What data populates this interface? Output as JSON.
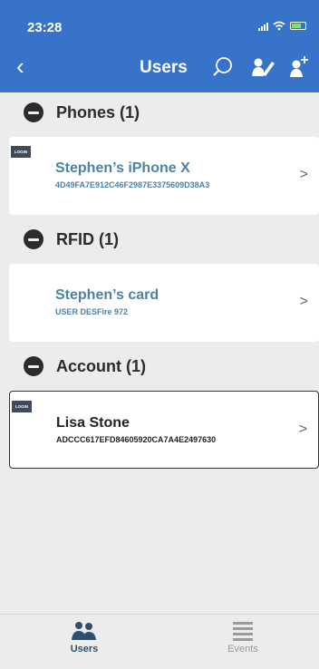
{
  "status_bar": {
    "time": "23:28"
  },
  "nav": {
    "title": "Users",
    "icons": [
      "back-chevron",
      "search-icon",
      "edit-user-icon",
      "add-user-icon"
    ]
  },
  "sections": [
    {
      "title": "Phones (1)",
      "items": [
        {
          "badge": "LOGIN",
          "name": "Stephen’s iPhone X",
          "detail": "4D49FA7E912C46F2987E3375609D38A3"
        }
      ]
    },
    {
      "title": "RFID (1)",
      "items": [
        {
          "name": "Stephen’s card",
          "detail": "USER DESFire 972"
        }
      ]
    },
    {
      "title": "Account (1)",
      "items": [
        {
          "badge": "LOGIN",
          "name": "Lisa Stone",
          "detail": "ADCCC617EFD84605920CA7A4E2497630"
        }
      ]
    }
  ],
  "tab_bar": {
    "tabs": [
      {
        "label": "Users",
        "icon": "users-icon",
        "active": true
      },
      {
        "label": "Events",
        "icon": "events-icon",
        "active": false
      }
    ]
  },
  "colors": {
    "header": "#3673c9",
    "link_text": "#4b82a6",
    "background": "#ececec"
  }
}
